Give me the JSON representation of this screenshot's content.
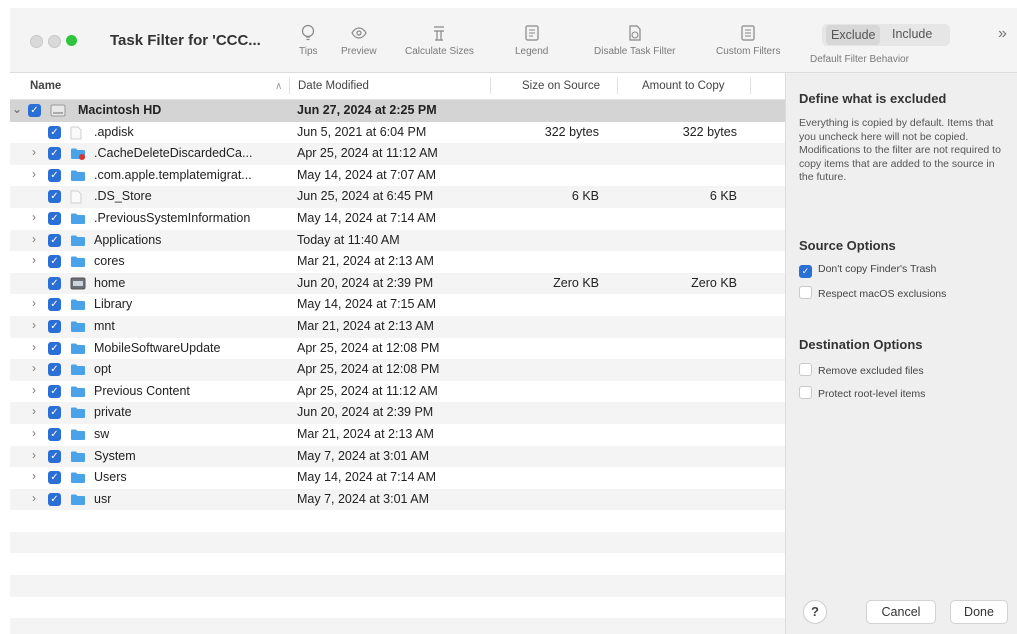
{
  "window": {
    "title": "Task Filter for 'CCC..."
  },
  "toolbar": {
    "items": [
      {
        "label": "Tips",
        "icon": "lightbulb-icon"
      },
      {
        "label": "Preview",
        "icon": "eye-icon"
      },
      {
        "label": "Calculate Sizes",
        "icon": "calculator-icon"
      },
      {
        "label": "Legend",
        "icon": "legend-icon"
      },
      {
        "label": "Disable Task Filter",
        "icon": "filter-off-icon"
      },
      {
        "label": "Custom Filters",
        "icon": "list-icon"
      }
    ],
    "segment": {
      "exclude": "Exclude",
      "include": "Include",
      "label": "Default Filter Behavior"
    },
    "overflow": "»"
  },
  "table": {
    "headers": {
      "name": "Name",
      "date": "Date Modified",
      "size": "Size on Source",
      "copy": "Amount to Copy"
    },
    "rows": [
      {
        "name": "Macintosh HD",
        "date": "Jun 27, 2024 at 2:25 PM",
        "size": "",
        "copy": ""
      },
      {
        "name": ".apdisk",
        "date": "Jun 5, 2021 at 6:04 PM",
        "size": "322 bytes",
        "copy": "322 bytes"
      },
      {
        "name": ".CacheDeleteDiscardedCa...",
        "date": "Apr 25, 2024 at 11:12 AM",
        "size": "",
        "copy": ""
      },
      {
        "name": ".com.apple.templatemigrat...",
        "date": "May 14, 2024 at 7:07 AM",
        "size": "",
        "copy": ""
      },
      {
        "name": ".DS_Store",
        "date": "Jun 25, 2024 at 6:45 PM",
        "size": "6 KB",
        "copy": "6 KB"
      },
      {
        "name": ".PreviousSystemInformation",
        "date": "May 14, 2024 at 7:14 AM",
        "size": "",
        "copy": ""
      },
      {
        "name": "Applications",
        "date": "Today at 11:40 AM",
        "size": "",
        "copy": ""
      },
      {
        "name": "cores",
        "date": "Mar 21, 2024 at 2:13 AM",
        "size": "",
        "copy": ""
      },
      {
        "name": "home",
        "date": "Jun 20, 2024 at 2:39 PM",
        "size": "Zero KB",
        "copy": "Zero KB"
      },
      {
        "name": "Library",
        "date": "May 14, 2024 at 7:15 AM",
        "size": "",
        "copy": ""
      },
      {
        "name": "mnt",
        "date": "Mar 21, 2024 at 2:13 AM",
        "size": "",
        "copy": ""
      },
      {
        "name": "MobileSoftwareUpdate",
        "date": "Apr 25, 2024 at 12:08 PM",
        "size": "",
        "copy": ""
      },
      {
        "name": "opt",
        "date": "Apr 25, 2024 at 12:08 PM",
        "size": "",
        "copy": ""
      },
      {
        "name": "Previous Content",
        "date": "Apr 25, 2024 at 11:12 AM",
        "size": "",
        "copy": ""
      },
      {
        "name": "private",
        "date": "Jun 20, 2024 at 2:39 PM",
        "size": "",
        "copy": ""
      },
      {
        "name": "sw",
        "date": "Mar 21, 2024 at 2:13 AM",
        "size": "",
        "copy": ""
      },
      {
        "name": "System",
        "date": "May 7, 2024 at 3:01 AM",
        "size": "",
        "copy": ""
      },
      {
        "name": "Users",
        "date": "May 14, 2024 at 7:14 AM",
        "size": "",
        "copy": ""
      },
      {
        "name": "usr",
        "date": "May 7, 2024 at 3:01 AM",
        "size": "",
        "copy": ""
      }
    ]
  },
  "sidebar": {
    "heading": "Define what is excluded",
    "description": "Everything is copied by default. Items that you uncheck here will not be copied. Modifications to the filter are not required to copy items that are added to the source in the future.",
    "source_heading": "Source Options",
    "source_options": [
      {
        "label": "Don't copy Finder's Trash",
        "checked": true
      },
      {
        "label": "Respect macOS exclusions",
        "checked": false
      }
    ],
    "dest_heading": "Destination Options",
    "dest_options": [
      {
        "label": "Remove excluded files",
        "checked": false
      },
      {
        "label": "Protect root-level items",
        "checked": false
      }
    ],
    "help": "?",
    "cancel": "Cancel",
    "done": "Done"
  },
  "colors": {
    "accent": "#2a6fd6",
    "folder": "#4aa3e8",
    "close_light": "#2ec43e"
  }
}
